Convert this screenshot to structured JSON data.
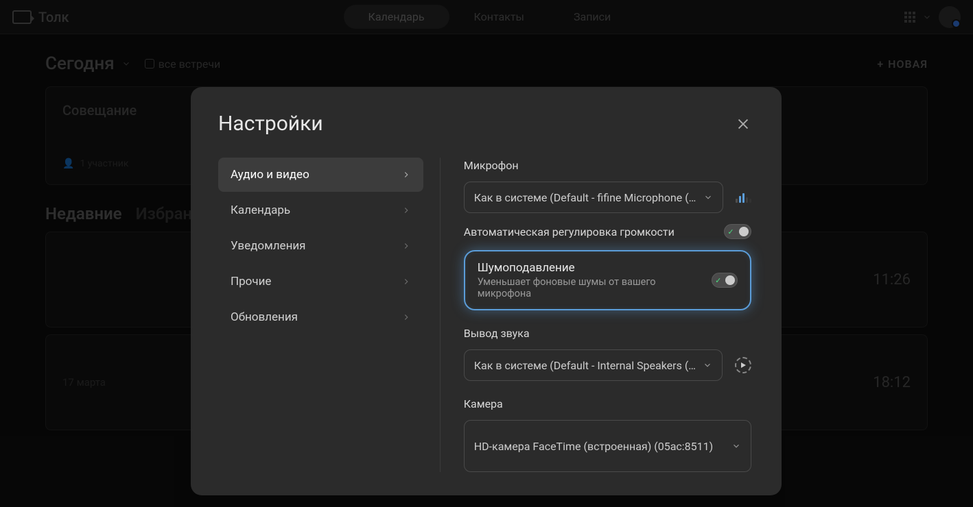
{
  "brand": "Толк",
  "nav": {
    "calendar": "Календарь",
    "contacts": "Контакты",
    "records": "Записи"
  },
  "header": {
    "today": "Сегодня",
    "all": "все встречи",
    "new": "НОВАЯ"
  },
  "card1": {
    "title": "Совещание",
    "participants": "1 участник"
  },
  "tabs2": {
    "recent": "Недавние",
    "fav": "Избранн"
  },
  "row1": {
    "time": "11:26"
  },
  "row2": {
    "date": "17 марта",
    "time": "18:12"
  },
  "modal": {
    "title": "Настройки",
    "nav": [
      "Аудио и видео",
      "Календарь",
      "Уведомления",
      "Прочие",
      "Обновления"
    ],
    "mic": {
      "label": "Микрофон",
      "value": "Как в системе (Default - fifine Microphone (…"
    },
    "agc": "Автоматическая регулировка громкости",
    "noise": {
      "title": "Шумоподавление",
      "desc": "Уменьшает фоновые шумы от вашего микрофона"
    },
    "output": {
      "label": "Вывод звука",
      "value": "Как в системе (Default - Internal Speakers (…"
    },
    "camera": {
      "label": "Камера",
      "value": "HD-камера FaceTime (встроенная) (05ac:8511)"
    }
  }
}
